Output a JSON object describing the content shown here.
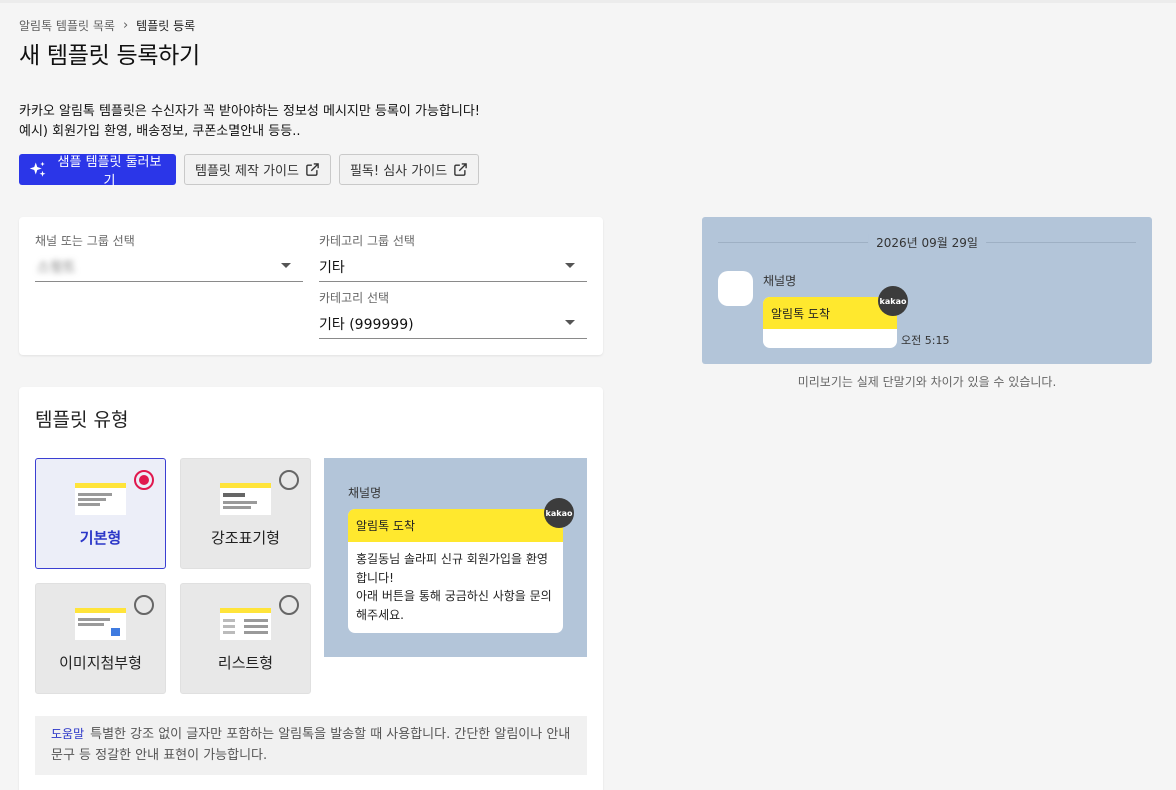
{
  "breadcrumb": {
    "parent": "알림톡 템플릿 목록",
    "separator": "›",
    "current": "템플릿 등록"
  },
  "page_title": "새 템플릿 등록하기",
  "intro": {
    "line1": "카카오 알림톡 템플릿은 수신자가 꼭 받아야하는 정보성 메시지만 등록이 가능합니다!",
    "line2": "예시) 회원가입 환영, 배송정보, 쿠폰소멸안내 등등.."
  },
  "buttons": {
    "sample": "샘플 템플릿 둘러보기",
    "guide": "템플릿 제작 가이드",
    "review": "필독! 심사 가이드"
  },
  "selects": {
    "channel": {
      "label": "채널 또는 그룹 선택",
      "value": "스윗트"
    },
    "category_group": {
      "label": "카테고리 그룹 선택",
      "value": "기타"
    },
    "category": {
      "label": "카테고리 선택",
      "value": "기타 (999999)"
    }
  },
  "template_type": {
    "title": "템플릿 유형",
    "options": [
      {
        "label": "기본형",
        "selected": true
      },
      {
        "label": "강조표기형",
        "selected": false
      },
      {
        "label": "이미지첨부형",
        "selected": false
      },
      {
        "label": "리스트형",
        "selected": false
      }
    ]
  },
  "type_preview": {
    "channel": "채널명",
    "header": "알림톡 도착",
    "body": [
      "홍길동님 솔라피 신규 회원가입을 환영",
      "합니다!",
      "아래 버튼을 통해 궁금하신 사항을 문의",
      "해주세요."
    ],
    "badge": "kakao"
  },
  "help": {
    "tag": "도움말",
    "text": "특별한 강조 없이 글자만 포함하는 알림톡을 발송할 때 사용합니다. 간단한 알림이나 안내문구 등 정갈한 안내 표현이 가능합니다."
  },
  "message_preview": {
    "date": "2026년 09월 29일",
    "channel": "채널명",
    "header": "알림톡 도착",
    "badge": "kakao",
    "time": "오전 5:15",
    "disclaimer": "미리보기는 실제 단말기와 차이가 있을 수 있습니다."
  },
  "colors": {
    "primary": "#2b36e8",
    "radio_selected": "#e0184e",
    "kakao_yellow": "#ffe82e",
    "preview_bg": "#b3c5d9"
  }
}
